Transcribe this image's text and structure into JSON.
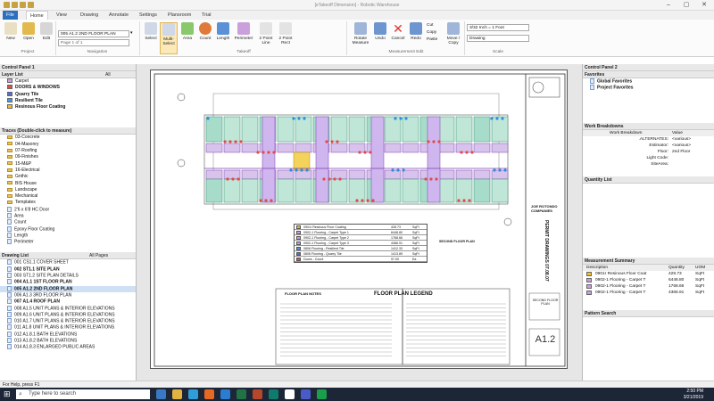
{
  "titlebar": {
    "title": "[eTakeoff Dimension] - Robotic Warehouse"
  },
  "ribbon_tabs": [
    "File",
    "Home",
    "View",
    "Drawing",
    "Annotate",
    "Settings",
    "Plansroom",
    "Trial"
  ],
  "ribbon": {
    "project": [
      "New",
      "Open",
      "Edit"
    ],
    "project_group": "Project",
    "drawing_select": "005 A1.2 2ND FLOOR PLAN",
    "page_select": "Page 1 of 1",
    "navigation_group": "Navigation",
    "takeoff": [
      "Select",
      "Multi-Select",
      "Area",
      "Count",
      "Length",
      "Perimeter",
      "2 Point Line",
      "2 Point Rect"
    ],
    "takeoff_group": "Takeoff",
    "measure": [
      "Rotate Measure",
      "Undo",
      "Cancel",
      "Redo",
      "Cut",
      "Copy",
      "Paste",
      "Move / Copy"
    ],
    "measure_group": "Measurement Edit",
    "scale_value": "3/32 Inch = 1 Foot",
    "scale_drawing": "Drawing",
    "scale_group": "Scale"
  },
  "left_panel": {
    "control_panel": "Control Panel 1",
    "layer_list_title": "Layer List",
    "layers_filter": "All",
    "layers": [
      {
        "name": "Carpet",
        "color": "#c9a0dc",
        "bold": false
      },
      {
        "name": "DOORS & WINDOWS",
        "color": "#e04b4b",
        "bold": true
      },
      {
        "name": "Quarry Tile",
        "color": "#5a6ad0",
        "bold": true
      },
      {
        "name": "Resilient Tile",
        "color": "#3e9ce6",
        "bold": true
      },
      {
        "name": "Resinous Floor Coating",
        "color": "#f0c020",
        "bold": true
      }
    ],
    "traces_title": "Traces (Double-click to measure)",
    "traces": [
      "03-Concrete",
      "04-Masonry",
      "07-Roofing",
      "09-Finishes",
      "15-M&P",
      "16-Electrical",
      "Gnthic",
      "BIS House",
      "Landscape",
      "Mechanical",
      "Templates",
      "2'6 x 6'8 HC Door",
      "Area",
      "Count",
      "Epoxy Floor Coating",
      "Length",
      "Perimeter"
    ],
    "drawing_list_title": "Drawing List",
    "drawings_filter": "All Pages",
    "drawings": [
      {
        "name": "001 CS1.1 COVER SHEET",
        "bold": false
      },
      {
        "name": "002 ST1.1 SITE PLAN",
        "bold": true
      },
      {
        "name": "003 ST1.2 SITE PLAN DETAILS",
        "bold": false
      },
      {
        "name": "004 A1.1 1ST FLOOR PLAN",
        "bold": true
      },
      {
        "name": "005 A1.2 2ND FLOOR PLAN",
        "bold": true
      },
      {
        "name": "006 A1.3 3RD FLOOR PLAN",
        "bold": false
      },
      {
        "name": "007 A1.4 ROOF PLAN",
        "bold": true
      },
      {
        "name": "008 A1.5 UNIT PLANS & INTERIOR ELEVATIONS",
        "bold": false
      },
      {
        "name": "009 A1.6 UNIT PLANS & INTERIOR ELEVATIONS",
        "bold": false
      },
      {
        "name": "010 A1.7 UNIT PLANS & INTERIOR ELEVATIONS",
        "bold": false
      },
      {
        "name": "011 A1.8 UNIT PLANS & INTERIOR ELEVATIONS",
        "bold": false
      },
      {
        "name": "012 A1.8.1 BATH ELEVATIONS",
        "bold": false
      },
      {
        "name": "013 A1.8.2 BATH ELEVATIONS",
        "bold": false
      },
      {
        "name": "014 A1.8.3 ENLARGED PUBLIC AREAS",
        "bold": false
      }
    ]
  },
  "right_panel": {
    "control_panel": "Control Panel 2",
    "favorites_title": "Favorites",
    "favorites": [
      "Global Favorites",
      "Project Favorites"
    ],
    "wb_title": "Work Breakdowns",
    "wb_headers": [
      "Work Breakdown",
      "Value"
    ],
    "wb_rows": [
      {
        "k": ".ALTERNATES:",
        "v": "<various>"
      },
      {
        "k": "Estimator:",
        "v": "<various>"
      },
      {
        "k": "Floor:",
        "v": "2nd Floor"
      },
      {
        "k": "Light Code:",
        "v": ""
      },
      {
        "k": "SiteArea:",
        "v": ""
      }
    ],
    "ql_title": "Quantity List",
    "ms_title": "Measurement Summary",
    "ms_headers": [
      "Description",
      "Quantity",
      "UOM"
    ],
    "ms_rows": [
      {
        "d": "0901r Resinous Floor Coat",
        "q": "428.73",
        "u": "SqFt",
        "c": "#f0c020"
      },
      {
        "d": "0902-1 Flooring - Carpet T",
        "q": "6448.80",
        "u": "SqFt",
        "c": "#c9a0dc"
      },
      {
        "d": "0902-1 Flooring - Carpet T",
        "q": "1768.66",
        "u": "SqFt",
        "c": "#c9a0dc"
      },
      {
        "d": "0902-1 Flooring - Carpet T",
        "q": "4366.91",
        "u": "SqFt",
        "c": "#c9a0dc"
      }
    ],
    "ps_title": "Pattern Search"
  },
  "drawing": {
    "legend": [
      {
        "d": "0901r Resinous Floor Coating",
        "q": "428.73",
        "u": "SqFt",
        "c": "#f0c020"
      },
      {
        "d": "0902-1 Flooring - Carpet Type 1",
        "q": "6448.80",
        "u": "SqFt",
        "c": "#c9a0dc"
      },
      {
        "d": "0902-1 Flooring - Carpet Type 2",
        "q": "1768.66",
        "u": "SqFt",
        "c": "#c9a0dc"
      },
      {
        "d": "0902-1 Flooring - Carpet Type 3",
        "q": "4366.91",
        "u": "SqFt",
        "c": "#c9a0dc"
      },
      {
        "d": "0806 Flooring - Resilient Tile",
        "q": "1412.33",
        "u": "SqFt",
        "c": "#3e9ce6"
      },
      {
        "d": "0806 Flooring - Quarry Tile",
        "q": "1413.89",
        "u": "SqFt",
        "c": "#5a6ad0"
      },
      {
        "d": "Doors - Count",
        "q": "97.00",
        "u": "Ea",
        "c": "#e04b4b"
      }
    ],
    "notes_title": "FLOOR PLAN NOTES",
    "legend_title": "FLOOR PLAN LEGEND",
    "plan_label": "SECOND FLOOR PLAN",
    "company": "JOE ROTONDO COMPANIES",
    "sheet_no": "A1.2",
    "sheet_name": "SECOND FLOOR PLAN",
    "permit": "PERMIT DRAWINGS 07.08.07"
  },
  "status": {
    "text": "For Help, press F1"
  },
  "taskbar": {
    "search": "Type here to search",
    "time": "2:50 PM",
    "date": "3/21/2019"
  }
}
